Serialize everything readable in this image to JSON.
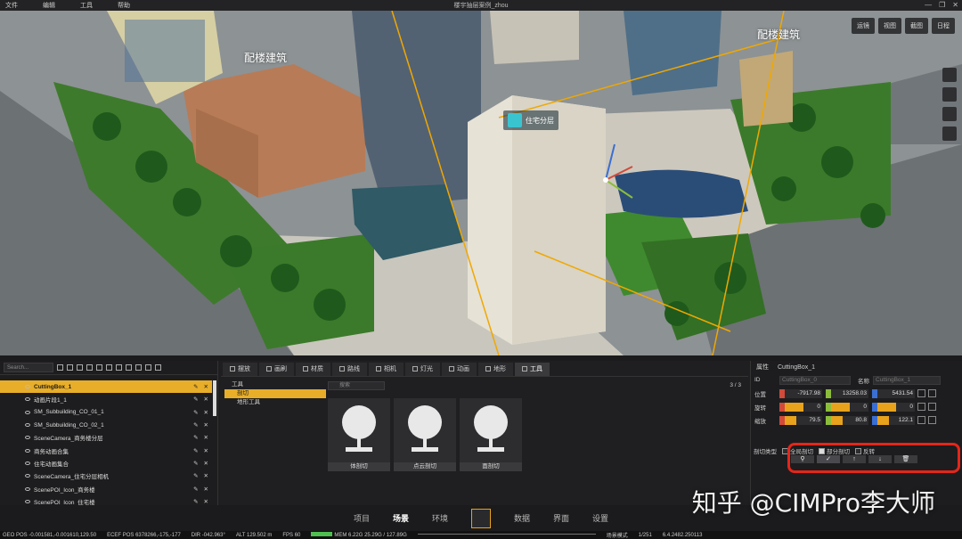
{
  "app": {
    "title": "楼宇抽层案例_zhou",
    "menu": [
      "文件",
      "编辑",
      "工具",
      "帮助"
    ],
    "window_controls": [
      "—",
      "❐",
      "✕"
    ]
  },
  "viewport": {
    "labels": {
      "peilou_left": "配楼建筑",
      "peilou_right": "配楼建筑",
      "zhuzhai_tag": "住宅分层"
    },
    "toolbar": [
      "运镜",
      "视图",
      "截图",
      "日程"
    ]
  },
  "scene_tree": {
    "search_placeholder": "Search...",
    "items": [
      {
        "label": "CuttingBox_1",
        "selected": true
      },
      {
        "label": "动画片段1_1"
      },
      {
        "label": "SM_Subbuilding_CO_01_1"
      },
      {
        "label": "SM_Subbuilding_CO_02_1"
      },
      {
        "label": "SceneCamera_商务楼分层"
      },
      {
        "label": "商务动画合集"
      },
      {
        "label": "住宅动画集合"
      },
      {
        "label": "SceneCamera_住宅分层相机"
      },
      {
        "label": "ScenePOI_Icon_商务楼"
      },
      {
        "label": "ScenePOI_Icon_住宅楼"
      }
    ]
  },
  "tabs": [
    "摆放",
    "画刷",
    "材质",
    "路线",
    "相机",
    "灯光",
    "动画",
    "地形",
    "工具"
  ],
  "active_tab": "工具",
  "tool_tree": {
    "root": "工具",
    "items": [
      "剖切",
      "地形工具"
    ]
  },
  "tool_area": {
    "search_placeholder": "搜索",
    "page": "3 / 3",
    "cards": [
      "体剖切",
      "点云剖切",
      "面剖切"
    ]
  },
  "properties": {
    "header": "属性",
    "object_name": "CuttingBox_1",
    "id_label": "ID",
    "id_value": "CuttingBox_0",
    "name_label": "名称",
    "name_value": "CuttingBox_1",
    "position_label": "位置",
    "position": [
      "-7917.98",
      "13258.03",
      "5431.54"
    ],
    "rotation_label": "旋转",
    "rotation": [
      "0",
      "0",
      "0"
    ],
    "scale_label": "缩放",
    "scale": [
      "79.5",
      "80.8",
      "122.1"
    ],
    "cut_type_label": "剖切类型",
    "options": [
      {
        "label": "全局剖切",
        "checked": false
      },
      {
        "label": "部分剖切",
        "checked": true
      },
      {
        "label": "反转",
        "checked": false
      }
    ],
    "buttons": [
      "⚲",
      "✓",
      "↑",
      "↓",
      "🗑"
    ]
  },
  "main_nav": [
    "项目",
    "场景",
    "环境",
    "数据",
    "界面",
    "设置"
  ],
  "main_nav_active": "场景",
  "statusbar": {
    "geo_pos": "GEO POS  -0.001581,-0.001610,129.50",
    "ecef_pos": "ECEF POS  6378266,-175,-177",
    "dir": "DIR  -042.963°",
    "alt": "ALT  129.502 m",
    "fps": "FPS  60",
    "mem": "MEM  6.22G  25.29G / 127.89G",
    "mode": "场景模式",
    "frame": "1/251",
    "version": "6.4.2482.250113"
  },
  "watermark": "知乎 @CIMPro李大师",
  "colors": {
    "accent": "#e8ae2a",
    "highlight": "#e5261a",
    "axis_x": "#d24a3a",
    "axis_y": "#8bbd3b",
    "axis_z": "#3a6ed2"
  }
}
